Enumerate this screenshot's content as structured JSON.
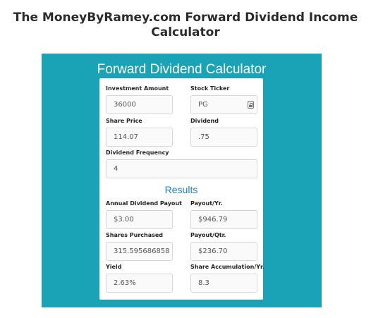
{
  "page": {
    "title_line1": "The MoneyByRamey.com Forward Dividend Income",
    "title_line2": "Calculator"
  },
  "calculator": {
    "title": "Forward Dividend Calculator",
    "inputs": {
      "investment_amount": {
        "label": "Investment Amount",
        "value": "36000"
      },
      "stock_ticker": {
        "label": "Stock Ticker",
        "value": "PG"
      },
      "share_price": {
        "label": "Share Price",
        "value": "114.07"
      },
      "dividend": {
        "label": "Dividend",
        "value": ".75"
      },
      "dividend_frequency": {
        "label": "Dividend Frequency",
        "value": "4"
      }
    },
    "results_heading": "Results",
    "results": {
      "annual_dividend_payout": {
        "label": "Annual Dividend Payout",
        "value": "$3.00"
      },
      "payout_yr": {
        "label": "Payout/Yr.",
        "value": "$946.79"
      },
      "shares_purchased": {
        "label": "Shares Purchased",
        "value": "315.595686858"
      },
      "payout_qtr": {
        "label": "Payout/Qtr.",
        "value": "$236.70"
      },
      "yield": {
        "label": "Yield",
        "value": "2.63%"
      },
      "share_accumulation_yr": {
        "label": "Share Accumulation/Yr.",
        "value": "8.3"
      }
    }
  },
  "colors": {
    "panel": "#1aa3b7",
    "results_heading": "#1e7fd0"
  },
  "icons": {
    "ticker_field": "lock-icon"
  }
}
